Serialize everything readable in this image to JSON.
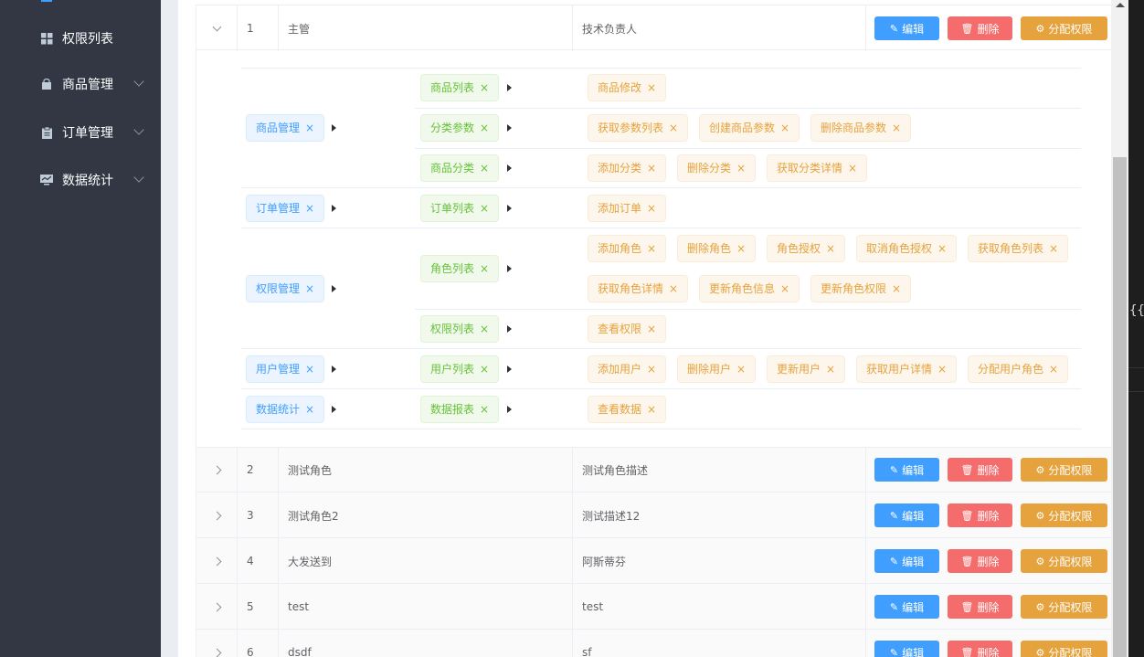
{
  "sidebar": {
    "items": [
      {
        "label": "权限列表",
        "icon": "grid-icon"
      },
      {
        "label": "商品管理",
        "icon": "shopping-bag-icon"
      },
      {
        "label": "订单管理",
        "icon": "clipboard-icon"
      },
      {
        "label": "数据统计",
        "icon": "monitor-chart-icon"
      }
    ]
  },
  "table": {
    "actions": {
      "edit": "编辑",
      "delete": "删除",
      "assign": "分配权限"
    },
    "rows": [
      {
        "index": "1",
        "name": "主管",
        "desc": "技术负责人",
        "expanded": true
      },
      {
        "index": "2",
        "name": "测试角色",
        "desc": "测试角色描述"
      },
      {
        "index": "3",
        "name": "测试角色2",
        "desc": "测试描述12"
      },
      {
        "index": "4",
        "name": "大发送到",
        "desc": "阿斯蒂芬"
      },
      {
        "index": "5",
        "name": "test",
        "desc": "test"
      },
      {
        "index": "6",
        "name": "dsdf",
        "desc": "sf"
      }
    ]
  },
  "rights": [
    {
      "name": "商品管理",
      "children": [
        {
          "name": "商品列表",
          "children": [
            "商品修改"
          ]
        },
        {
          "name": "分类参数",
          "children": [
            "获取参数列表",
            "创建商品参数",
            "删除商品参数"
          ]
        },
        {
          "name": "商品分类",
          "children": [
            "添加分类",
            "删除分类",
            "获取分类详情"
          ]
        }
      ]
    },
    {
      "name": "订单管理",
      "children": [
        {
          "name": "订单列表",
          "children": [
            "添加订单"
          ]
        }
      ]
    },
    {
      "name": "权限管理",
      "children": [
        {
          "name": "角色列表",
          "children": [
            "添加角色",
            "删除角色",
            "角色授权",
            "取消角色授权",
            "获取角色列表",
            "获取角色详情",
            "更新角色信息",
            "更新角色权限"
          ]
        },
        {
          "name": "权限列表",
          "children": [
            "查看权限"
          ]
        }
      ]
    },
    {
      "name": "用户管理",
      "children": [
        {
          "name": "用户列表",
          "children": [
            "添加用户",
            "删除用户",
            "更新用户",
            "获取用户详情",
            "分配用户角色"
          ]
        }
      ]
    },
    {
      "name": "数据统计",
      "children": [
        {
          "name": "数据报表",
          "children": [
            "查看数据"
          ]
        }
      ]
    }
  ],
  "editor": {
    "snippet": "{{"
  },
  "colors": {
    "primary": "#409eff",
    "danger": "#f56c6c",
    "warning": "#e6a23c",
    "success": "#67c23a",
    "sidebar": "#333744"
  }
}
